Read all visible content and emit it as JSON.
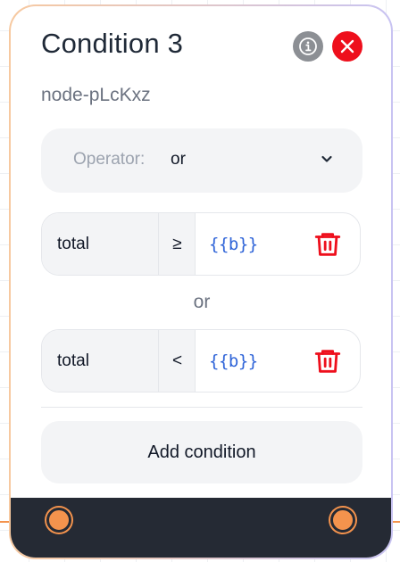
{
  "node": {
    "title": "Condition 3",
    "id": "node-pLcKxz"
  },
  "operator": {
    "label": "Operator:",
    "value": "or"
  },
  "conditions": [
    {
      "field": "total",
      "operator": "≥",
      "value": "{{b}}"
    },
    {
      "field": "total",
      "operator": "<",
      "value": "{{b}}"
    }
  ],
  "separator": "or",
  "add_condition_label": "Add condition",
  "icons": {
    "info": "info-icon",
    "close": "close-icon",
    "chevron": "chevron-down-icon",
    "trash": "trash-icon"
  },
  "colors": {
    "accent": "#f4934d",
    "danger": "#ee0f1c",
    "footer": "#252a34",
    "template_value": "#2f64d8"
  }
}
